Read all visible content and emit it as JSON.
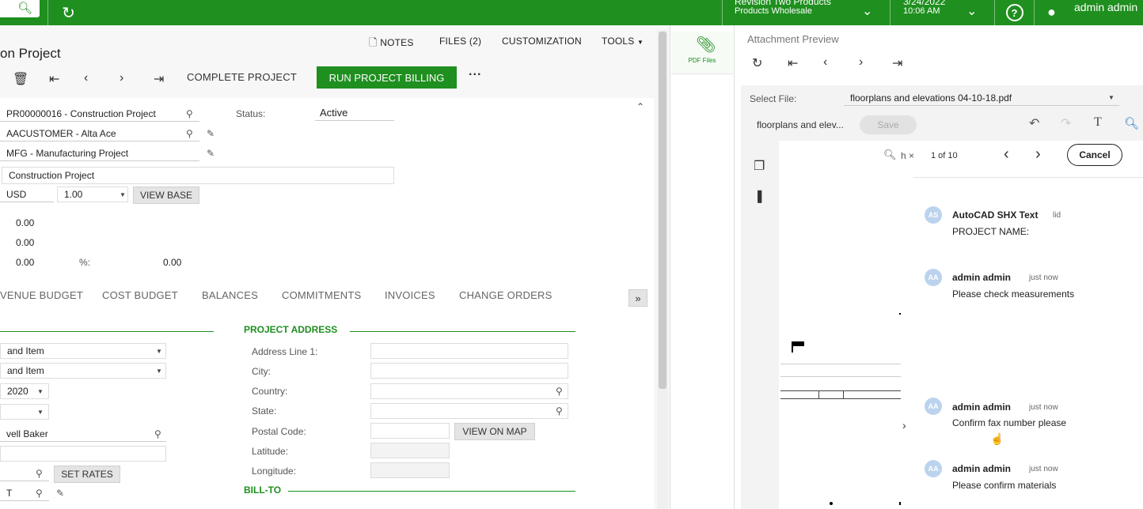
{
  "topbar": {
    "company": "Revision Two Products",
    "branch": "Products Wholesale",
    "date": "3/24/2022",
    "time": "10:06 AM",
    "user": "admin admin"
  },
  "screen": {
    "title": "on Project",
    "actions": {
      "notes": "NOTES",
      "files": "FILES (2)",
      "customization": "CUSTOMIZATION",
      "tools": "TOOLS"
    },
    "toolbar": {
      "complete": "COMPLETE PROJECT",
      "run_billing": "RUN PROJECT BILLING",
      "more": "···"
    }
  },
  "form": {
    "project_id": "PR00000016 - Construction Project",
    "customer": "AACUSTOMER - Alta Ace",
    "template": "MFG - Manufacturing Project",
    "description": "Construction Project",
    "currency": "USD",
    "rate": "1.00",
    "view_base": "VIEW BASE",
    "status_label": "Status:",
    "status_value": "Active",
    "amount1": "0.00",
    "amount2": "0.00",
    "amount3": "0.00",
    "pct_label": "%:",
    "pct_value": "0.00"
  },
  "tabs": [
    "VENUE BUDGET",
    "COST BUDGET",
    "BALANCES",
    "COMMITMENTS",
    "INVOICES",
    "CHANGE ORDERS"
  ],
  "tabs_more": "»",
  "left_fields": {
    "f1": "and Item",
    "f2": "and Item",
    "f3": "2020",
    "f5": "vell Baker",
    "set_rates": "SET RATES",
    "f8": "T"
  },
  "address": {
    "section": "PROJECT ADDRESS",
    "line1": "Address Line 1:",
    "city": "City:",
    "country": "Country:",
    "state": "State:",
    "postal": "Postal Code:",
    "view_map": "VIEW ON MAP",
    "latitude": "Latitude:",
    "longitude": "Longitude:",
    "billto": "BILL-TO"
  },
  "files_panel": {
    "label": "PDF Files"
  },
  "preview": {
    "title": "Attachment Preview",
    "select_label": "Select File:",
    "selected_file": "floorplans and elevations 04-10-18.pdf",
    "file_short": "floorplans and elev...",
    "save": "Save",
    "search_text": "h",
    "search_count": "1 of 10",
    "cancel": "Cancel"
  },
  "comments": [
    {
      "initials": "AS",
      "name": "AutoCAD SHX Text",
      "time": "lid",
      "text": "PROJECT NAME:"
    },
    {
      "initials": "AA",
      "name": "admin admin",
      "time": "just now",
      "text": "Please check measurements"
    },
    {
      "initials": "AA",
      "name": "admin admin",
      "time": "just now",
      "text": "Confirm fax number please"
    },
    {
      "initials": "AA",
      "name": "admin admin",
      "time": "just now",
      "text": "Please confirm materials"
    }
  ],
  "colors": {
    "accent": "#1f8f1f",
    "avatar": "#bcd3ee"
  }
}
